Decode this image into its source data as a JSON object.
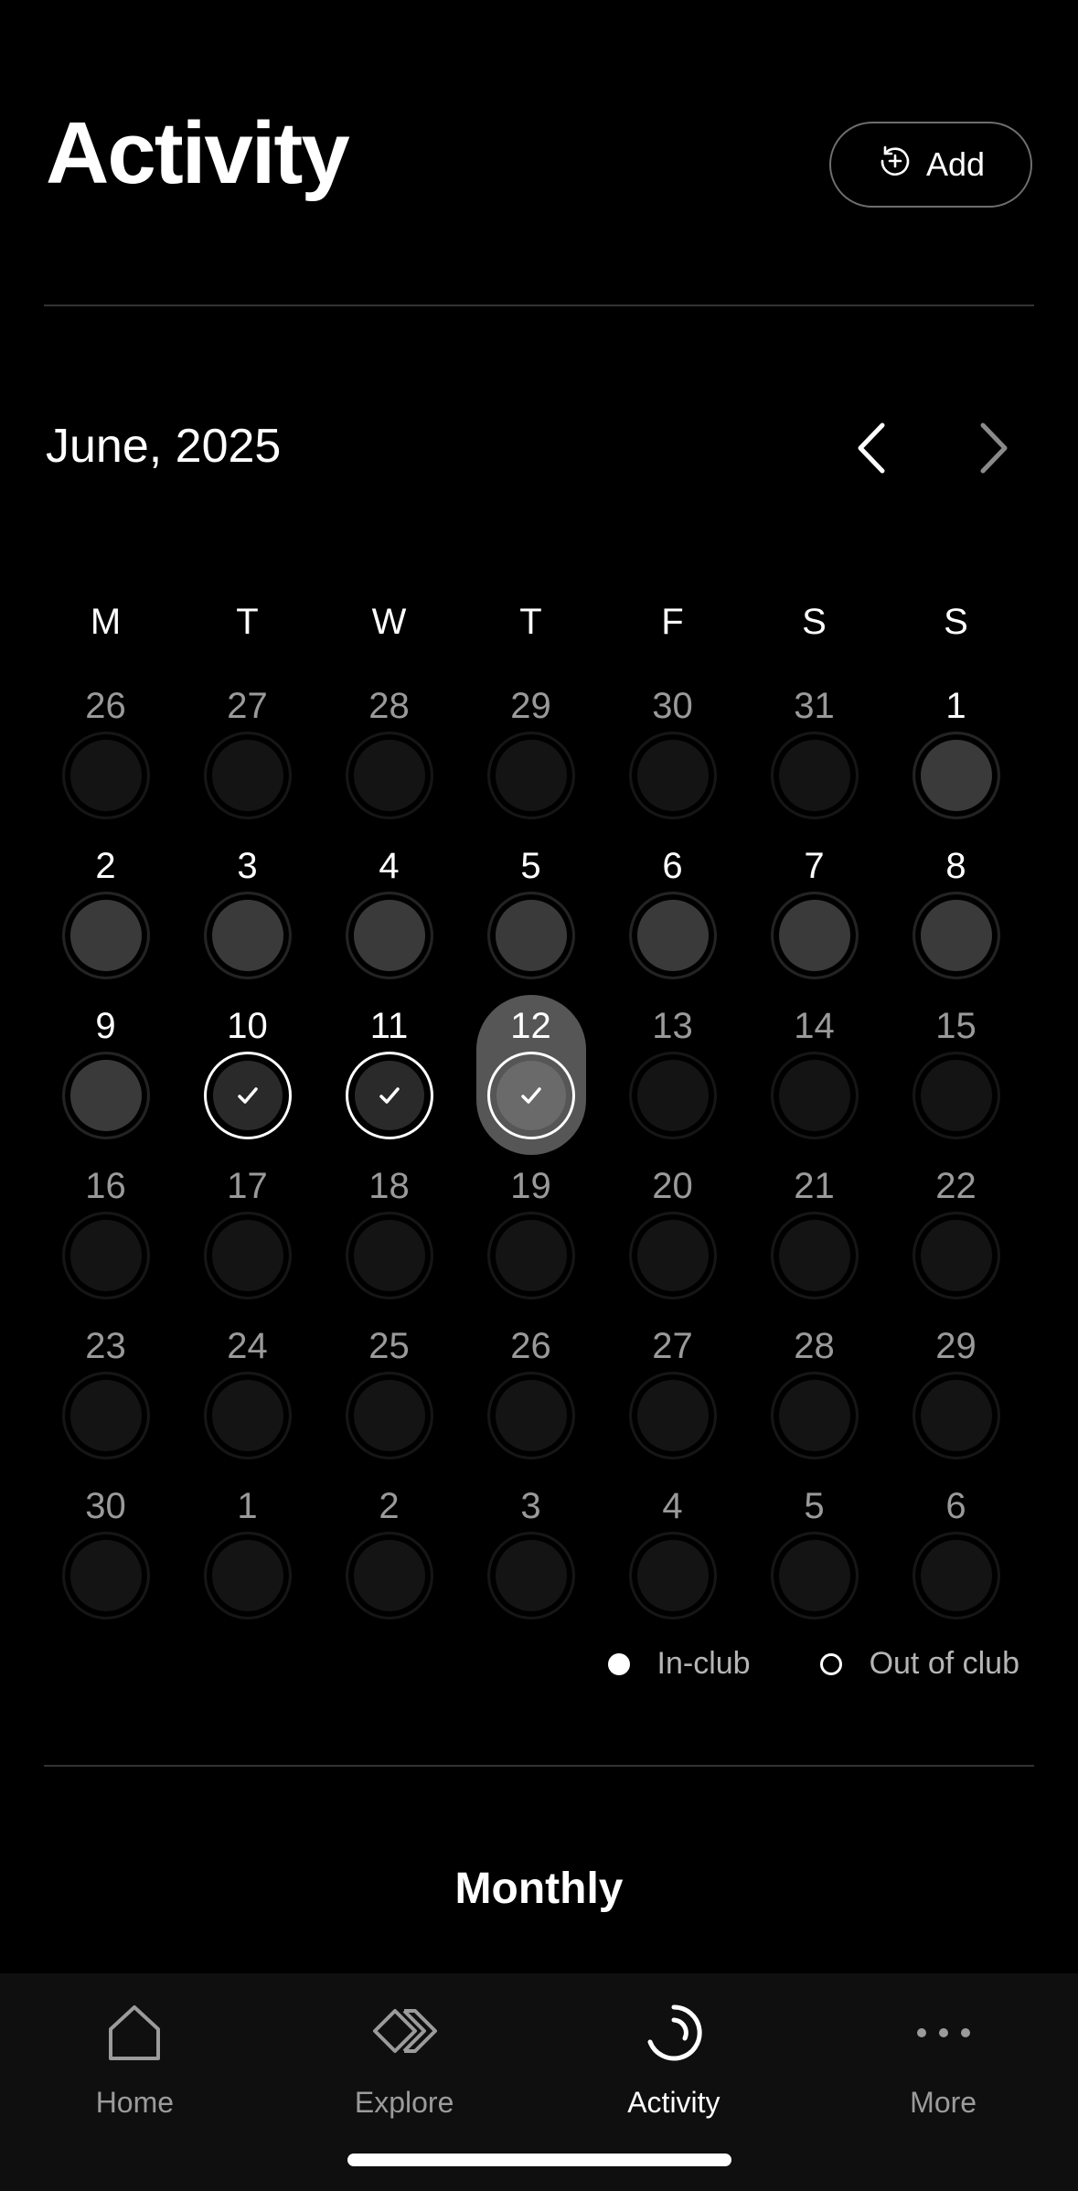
{
  "header": {
    "title": "Activity",
    "add_button_label": "Add"
  },
  "calendar": {
    "month_label": "June, 2025",
    "weekdays": [
      "M",
      "T",
      "W",
      "T",
      "F",
      "S",
      "S"
    ],
    "weeks": [
      [
        {
          "day": "26",
          "state": "dim"
        },
        {
          "day": "27",
          "state": "dim"
        },
        {
          "day": "28",
          "state": "dim"
        },
        {
          "day": "29",
          "state": "dim"
        },
        {
          "day": "30",
          "state": "dim"
        },
        {
          "day": "31",
          "state": "dim"
        },
        {
          "day": "1",
          "state": "current"
        }
      ],
      [
        {
          "day": "2",
          "state": "current"
        },
        {
          "day": "3",
          "state": "current"
        },
        {
          "day": "4",
          "state": "current"
        },
        {
          "day": "5",
          "state": "current"
        },
        {
          "day": "6",
          "state": "current"
        },
        {
          "day": "7",
          "state": "current"
        },
        {
          "day": "8",
          "state": "current"
        }
      ],
      [
        {
          "day": "9",
          "state": "current"
        },
        {
          "day": "10",
          "state": "done"
        },
        {
          "day": "11",
          "state": "done"
        },
        {
          "day": "12",
          "state": "selected"
        },
        {
          "day": "13",
          "state": "dim"
        },
        {
          "day": "14",
          "state": "dim"
        },
        {
          "day": "15",
          "state": "dim"
        }
      ],
      [
        {
          "day": "16",
          "state": "dim"
        },
        {
          "day": "17",
          "state": "dim"
        },
        {
          "day": "18",
          "state": "dim"
        },
        {
          "day": "19",
          "state": "dim"
        },
        {
          "day": "20",
          "state": "dim"
        },
        {
          "day": "21",
          "state": "dim"
        },
        {
          "day": "22",
          "state": "dim"
        }
      ],
      [
        {
          "day": "23",
          "state": "dim"
        },
        {
          "day": "24",
          "state": "dim"
        },
        {
          "day": "25",
          "state": "dim"
        },
        {
          "day": "26",
          "state": "dim"
        },
        {
          "day": "27",
          "state": "dim"
        },
        {
          "day": "28",
          "state": "dim"
        },
        {
          "day": "29",
          "state": "dim"
        }
      ],
      [
        {
          "day": "30",
          "state": "dim"
        },
        {
          "day": "1",
          "state": "dim"
        },
        {
          "day": "2",
          "state": "dim"
        },
        {
          "day": "3",
          "state": "dim"
        },
        {
          "day": "4",
          "state": "dim"
        },
        {
          "day": "5",
          "state": "dim"
        },
        {
          "day": "6",
          "state": "dim"
        }
      ]
    ]
  },
  "legend": {
    "in_club": "In-club",
    "out_of_club": "Out of club"
  },
  "section": {
    "title": "Monthly"
  },
  "tabbar": {
    "items": [
      {
        "label": "Home",
        "icon": "home-icon",
        "active": false
      },
      {
        "label": "Explore",
        "icon": "explore-icon",
        "active": false
      },
      {
        "label": "Activity",
        "icon": "activity-icon",
        "active": true
      },
      {
        "label": "More",
        "icon": "more-icon",
        "active": false
      }
    ]
  },
  "colors": {
    "background": "#000000",
    "tabbar": "#0f0f10",
    "selected_pill": "#565656",
    "muted_text": "#9a9a9a"
  }
}
